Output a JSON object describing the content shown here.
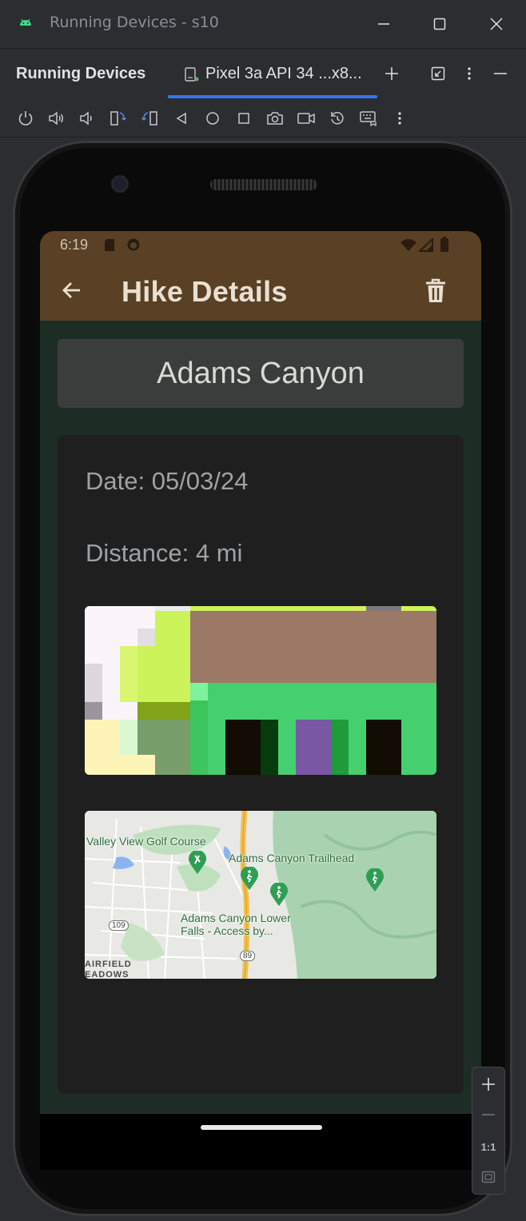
{
  "window": {
    "title": "Running Devices - s10",
    "app_icon": "android-icon",
    "controls": [
      "minimize-icon",
      "maximize-icon",
      "close-icon"
    ]
  },
  "panel": {
    "title": "Running Devices",
    "device_tab": {
      "label": "Pixel 3a API 34 ...x8...",
      "icon": "device-icon"
    },
    "actions": [
      "add-icon",
      "restore-icon",
      "more-vertical-icon",
      "minimize-panel-icon"
    ]
  },
  "toolbar": {
    "buttons": [
      "power-icon",
      "volume-up-icon",
      "volume-down-icon",
      "rotate-left-icon",
      "rotate-right-icon",
      "back-icon",
      "home-icon",
      "overview-icon",
      "screenshot-icon",
      "screen-record-icon",
      "reset-icon",
      "keyboard-icon",
      "more-vertical-icon"
    ]
  },
  "device": {
    "status_bar": {
      "time": "6:19",
      "icons": [
        "sd-card-icon",
        "app-notification-icon",
        "wifi-icon",
        "signal-icon",
        "battery-icon"
      ]
    },
    "app_bar": {
      "title": "Hike Details",
      "back_icon": "arrow-back-icon",
      "delete_icon": "trash-icon"
    },
    "hike": {
      "name": "Adams Canyon",
      "date": "Date: 05/03/24",
      "distance": "Distance: 4 mi"
    },
    "map": {
      "labels": {
        "golf": "Valley View Golf Course",
        "trailhead": "Adams Canyon Trailhead",
        "falls_line1": "Adams Canyon Lower",
        "falls_line2": "Falls - Access by...",
        "fairfield_line1": "AIRFIELD",
        "fairfield_line2": "EADOWS",
        "route_109": "109",
        "route_89": "89"
      }
    }
  },
  "zoom_panel": {
    "zoom_in": "zoom-in-icon",
    "zoom_out": "zoom-out-icon",
    "actual_size_label": "1:1",
    "fit_icon": "fit-screen-icon"
  },
  "colors": {
    "ide_bg": "#2b2d30",
    "accent": "#3574f0",
    "app_bar": "#5a4024",
    "screen_bg": "#1e2c26",
    "card_bg": "#1f1f1f"
  }
}
